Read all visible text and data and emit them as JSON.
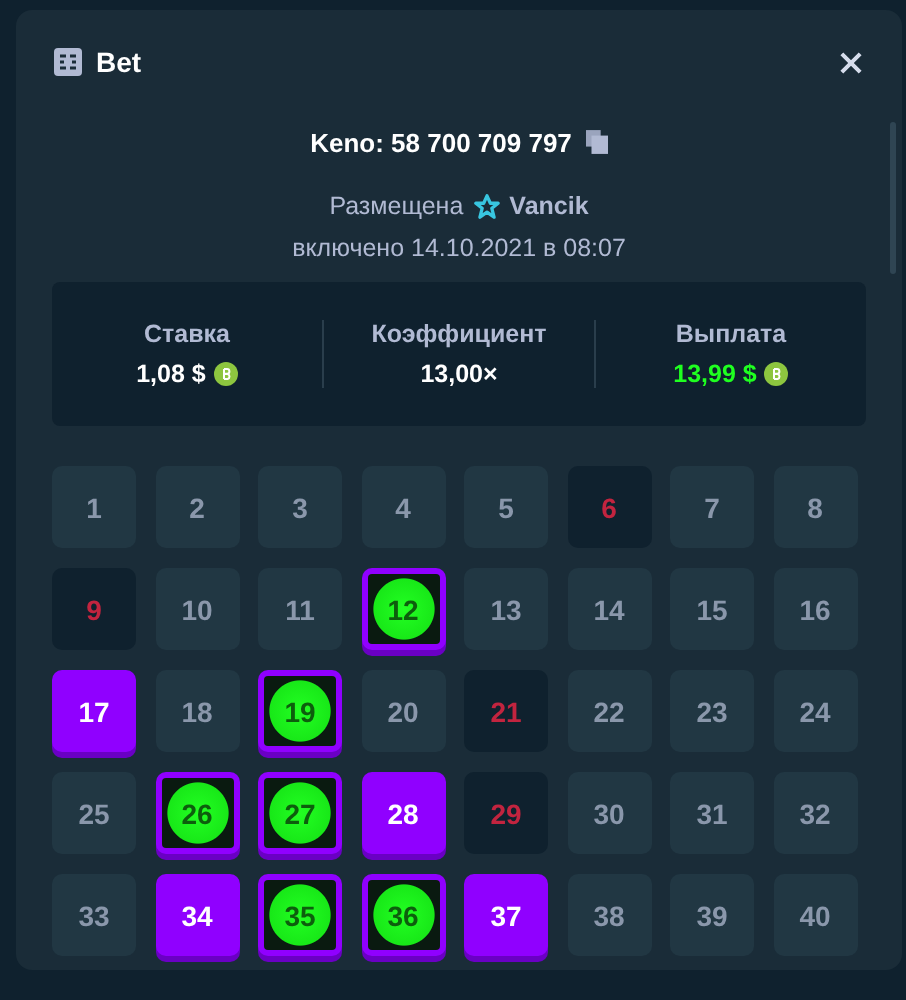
{
  "modal": {
    "title": "Bet",
    "bet_title": "Keno: 58 700 709 797",
    "placed_label": "Размещена",
    "user": "Vancik",
    "date": "включено 14.10.2021 в 08:07"
  },
  "stats": [
    {
      "label": "Ставка",
      "value": "1,08 $",
      "kind": "currency",
      "win": false
    },
    {
      "label": "Коэффициент",
      "value": "13,00×",
      "kind": "multiplier",
      "win": false
    },
    {
      "label": "Выплата",
      "value": "13,99 $",
      "kind": "currency",
      "win": true
    }
  ],
  "tiles": [
    {
      "number": "1",
      "kind": "normal"
    },
    {
      "number": "2",
      "kind": "normal"
    },
    {
      "number": "3",
      "kind": "normal"
    },
    {
      "number": "4",
      "kind": "normal"
    },
    {
      "number": "5",
      "kind": "normal"
    },
    {
      "number": "6",
      "kind": "miss"
    },
    {
      "number": "7",
      "kind": "normal"
    },
    {
      "number": "8",
      "kind": "normal"
    },
    {
      "number": "9",
      "kind": "miss"
    },
    {
      "number": "10",
      "kind": "normal"
    },
    {
      "number": "11",
      "kind": "normal"
    },
    {
      "number": "12",
      "kind": "hit"
    },
    {
      "number": "13",
      "kind": "normal"
    },
    {
      "number": "14",
      "kind": "normal"
    },
    {
      "number": "15",
      "kind": "normal"
    },
    {
      "number": "16",
      "kind": "normal"
    },
    {
      "number": "17",
      "kind": "picked"
    },
    {
      "number": "18",
      "kind": "normal"
    },
    {
      "number": "19",
      "kind": "hit"
    },
    {
      "number": "20",
      "kind": "normal"
    },
    {
      "number": "21",
      "kind": "miss"
    },
    {
      "number": "22",
      "kind": "normal"
    },
    {
      "number": "23",
      "kind": "normal"
    },
    {
      "number": "24",
      "kind": "normal"
    },
    {
      "number": "25",
      "kind": "normal"
    },
    {
      "number": "26",
      "kind": "hit"
    },
    {
      "number": "27",
      "kind": "hit"
    },
    {
      "number": "28",
      "kind": "picked"
    },
    {
      "number": "29",
      "kind": "miss"
    },
    {
      "number": "30",
      "kind": "normal"
    },
    {
      "number": "31",
      "kind": "normal"
    },
    {
      "number": "32",
      "kind": "normal"
    },
    {
      "number": "33",
      "kind": "normal"
    },
    {
      "number": "34",
      "kind": "picked"
    },
    {
      "number": "35",
      "kind": "hit"
    },
    {
      "number": "36",
      "kind": "hit"
    },
    {
      "number": "37",
      "kind": "picked"
    },
    {
      "number": "38",
      "kind": "normal"
    },
    {
      "number": "39",
      "kind": "normal"
    },
    {
      "number": "40",
      "kind": "normal"
    }
  ]
}
